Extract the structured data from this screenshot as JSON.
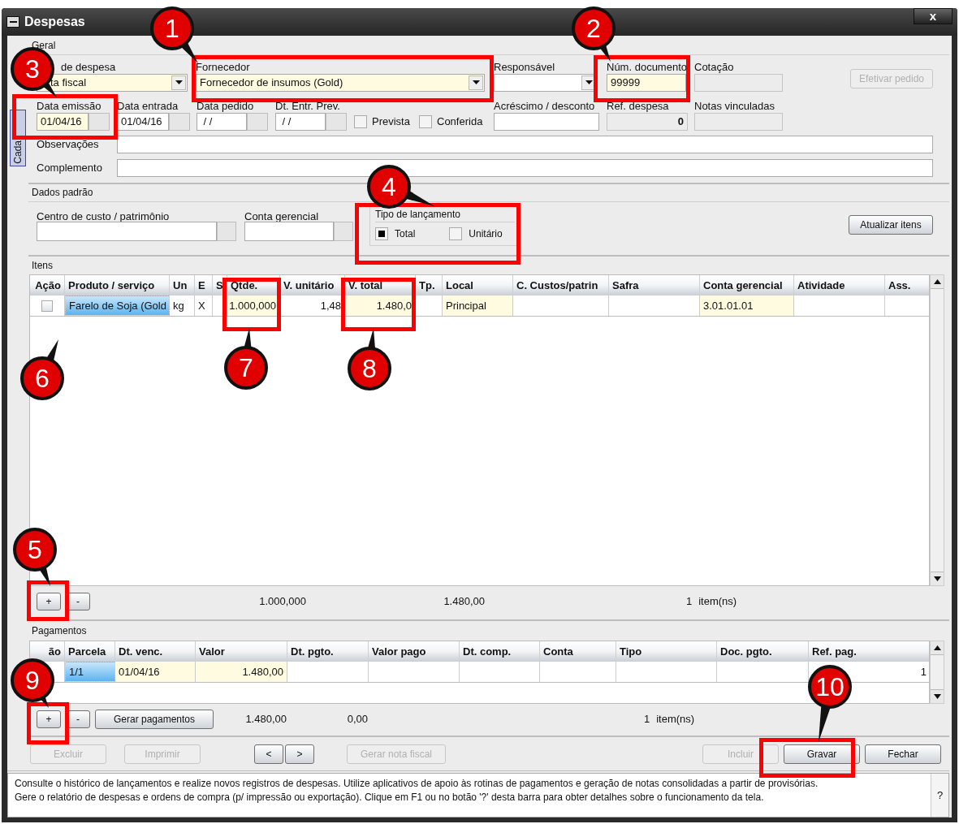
{
  "window": {
    "title": "Despesas",
    "close": "x"
  },
  "side_tab": {
    "label": "Cada"
  },
  "geral": {
    "title": "Geral",
    "row1": [
      {
        "label": "de despesa",
        "value": "ta fiscal",
        "kind": "combo",
        "required": true,
        "disabled": false
      },
      {
        "label": "Fornecedor",
        "value": "Fornecedor de insumos (Gold)",
        "kind": "combo",
        "required": true,
        "disabled": false
      },
      {
        "label": "Responsável",
        "kind": "combo",
        "required": false,
        "disabled": false
      },
      {
        "label": "Núm. documento",
        "value": "99999",
        "kind": "text",
        "required": true,
        "disabled": false
      },
      {
        "label": "Cotação",
        "kind": "text",
        "required": false,
        "disabled": true
      }
    ],
    "action_button": {
      "label": "Efetivar pedido",
      "disabled": true
    },
    "row2": [
      {
        "label": "Data emissão",
        "value": "01/04/16",
        "kind": "date",
        "required": true,
        "disabled": false
      },
      {
        "label": "Data entrada",
        "value": "01/04/16",
        "kind": "date",
        "required": false,
        "disabled": false
      },
      {
        "label": "Data pedido",
        "value": " / /",
        "kind": "date",
        "required": false,
        "disabled": false
      },
      {
        "label": "Dt. Entr. Prev.",
        "value": " / /",
        "kind": "date",
        "required": false,
        "disabled": false
      },
      {
        "label": "Prevista",
        "kind": "checkbox",
        "checked": false
      },
      {
        "label": "Conferida",
        "kind": "checkbox",
        "checked": false
      },
      {
        "label": "Acréscimo / desconto",
        "kind": "text",
        "required": false,
        "disabled": false
      },
      {
        "label": "Ref. despesa",
        "value": "0",
        "kind": "number",
        "required": false,
        "disabled": true
      },
      {
        "label": "Notas vinculadas",
        "kind": "text",
        "required": false,
        "disabled": true
      }
    ],
    "notes": [
      {
        "label": "Observações"
      },
      {
        "label": "Complemento"
      }
    ]
  },
  "dados_padrao": {
    "title": "Dados padrão",
    "fields": [
      {
        "label": "Centro de custo / patrimônio"
      },
      {
        "label": "Conta gerencial"
      }
    ],
    "launch_type": {
      "label": "Tipo de lançamento",
      "options": [
        {
          "label": "Total",
          "selected": true
        },
        {
          "label": "Unitário",
          "selected": false
        }
      ]
    },
    "button": "Atualizar itens"
  },
  "itens": {
    "title": "Itens",
    "columns": [
      "Ação",
      "Produto / serviço",
      "Un",
      "E",
      "S",
      "Qtde.",
      "V. unitário",
      "V. total",
      "Tp.",
      "Local",
      "C. Custos/patrin",
      "Safra",
      "Conta gerencial",
      "Atividade",
      "Ass."
    ],
    "rows": [
      {
        "cells": [
          {
            "kind": "checkbox",
            "checked": false
          },
          {
            "kind": "text",
            "text": "Farelo de Soja (Gold",
            "editable": false,
            "selected": true
          },
          {
            "kind": "text",
            "text": "kg",
            "editable": false,
            "selected": false
          },
          {
            "kind": "text",
            "text": "X",
            "editable": false,
            "selected": false
          },
          {
            "kind": "text",
            "editable": false,
            "selected": false
          },
          {
            "kind": "text",
            "text": "1.000,000",
            "editable": true,
            "selected": false
          },
          {
            "kind": "text",
            "text": "1,48",
            "editable": false,
            "selected": false
          },
          {
            "kind": "text",
            "text": "1.480,0",
            "editable": true,
            "selected": false
          },
          {
            "kind": "text",
            "editable": false,
            "selected": false
          },
          {
            "kind": "text",
            "text": "Principal",
            "editable": true,
            "selected": false
          },
          {
            "kind": "text",
            "editable": false,
            "selected": false
          },
          {
            "kind": "text",
            "editable": false,
            "selected": false
          },
          {
            "kind": "text",
            "text": "3.01.01.01",
            "editable": true,
            "selected": false
          },
          {
            "kind": "text",
            "editable": false,
            "selected": false
          },
          {
            "kind": "text",
            "editable": false,
            "selected": false
          }
        ]
      }
    ],
    "footer": {
      "buttons": [
        "+",
        "-"
      ],
      "qty_total": "1.000,000",
      "value_total": "1.480,00",
      "count": "1",
      "count_label": "item(ns)"
    }
  },
  "pagamentos": {
    "title": "Pagamentos",
    "columns": [
      "ão",
      "Parcela",
      "Dt. venc.",
      "Valor",
      "Dt. pgto.",
      "Valor pago",
      "Dt. comp.",
      "Conta",
      "Tipo",
      "Doc. pgto.",
      "Ref. pag."
    ],
    "rows": [
      {
        "cells": [
          {
            "kind": "text",
            "editable": false,
            "selected": false
          },
          {
            "kind": "text",
            "text": "1/1",
            "editable": false,
            "selected": true
          },
          {
            "kind": "text",
            "text": "01/04/16",
            "editable": true,
            "selected": false
          },
          {
            "kind": "text",
            "text": "1.480,00",
            "editable": true,
            "selected": false
          },
          {
            "kind": "text",
            "editable": false,
            "selected": false
          },
          {
            "kind": "text",
            "editable": false,
            "selected": false
          },
          {
            "kind": "text",
            "editable": false,
            "selected": false
          },
          {
            "kind": "text",
            "editable": false,
            "selected": false
          },
          {
            "kind": "text",
            "editable": false,
            "selected": false
          },
          {
            "kind": "text",
            "editable": false,
            "selected": false
          },
          {
            "kind": "text",
            "text": "1",
            "editable": false,
            "selected": false
          }
        ]
      }
    ],
    "footer": {
      "buttons": [
        "+",
        "-"
      ],
      "generate": "Gerar pagamentos",
      "value_total": "1.480,00",
      "paid_total": "0,00",
      "count": "1",
      "count_label": "item(ns)"
    }
  },
  "actions": [
    {
      "label": "Excluir",
      "disabled": true
    },
    {
      "label": "Imprimir",
      "disabled": true
    },
    {
      "label": "<",
      "disabled": false
    },
    {
      "label": ">",
      "disabled": false
    },
    {
      "label": "Gerar nota fiscal",
      "disabled": true
    },
    {
      "label": "Incluir",
      "disabled": true
    },
    {
      "label": "Gravar",
      "disabled": false
    },
    {
      "label": "Fechar",
      "disabled": false
    }
  ],
  "help": {
    "lines": [
      "Consulte o histórico de lançamentos e realize novos registros de despesas. Utilize aplicativos de apoio às rotinas de pagamentos e geração de notas consolidadas a partir de provisórias.",
      "Gere o relatório de despesas e ordens de compra (p/ impressão ou exportação). Clique em F1 ou no botão '?' desta barra para obter detalhes sobre o funcionamento da tela."
    ],
    "button": "?"
  },
  "callouts": [
    {
      "number": "1"
    },
    {
      "number": "2"
    },
    {
      "number": "3"
    },
    {
      "number": "4"
    },
    {
      "number": "5"
    },
    {
      "number": "6"
    },
    {
      "number": "7"
    },
    {
      "number": "8"
    },
    {
      "number": "9"
    },
    {
      "number": "10"
    }
  ]
}
